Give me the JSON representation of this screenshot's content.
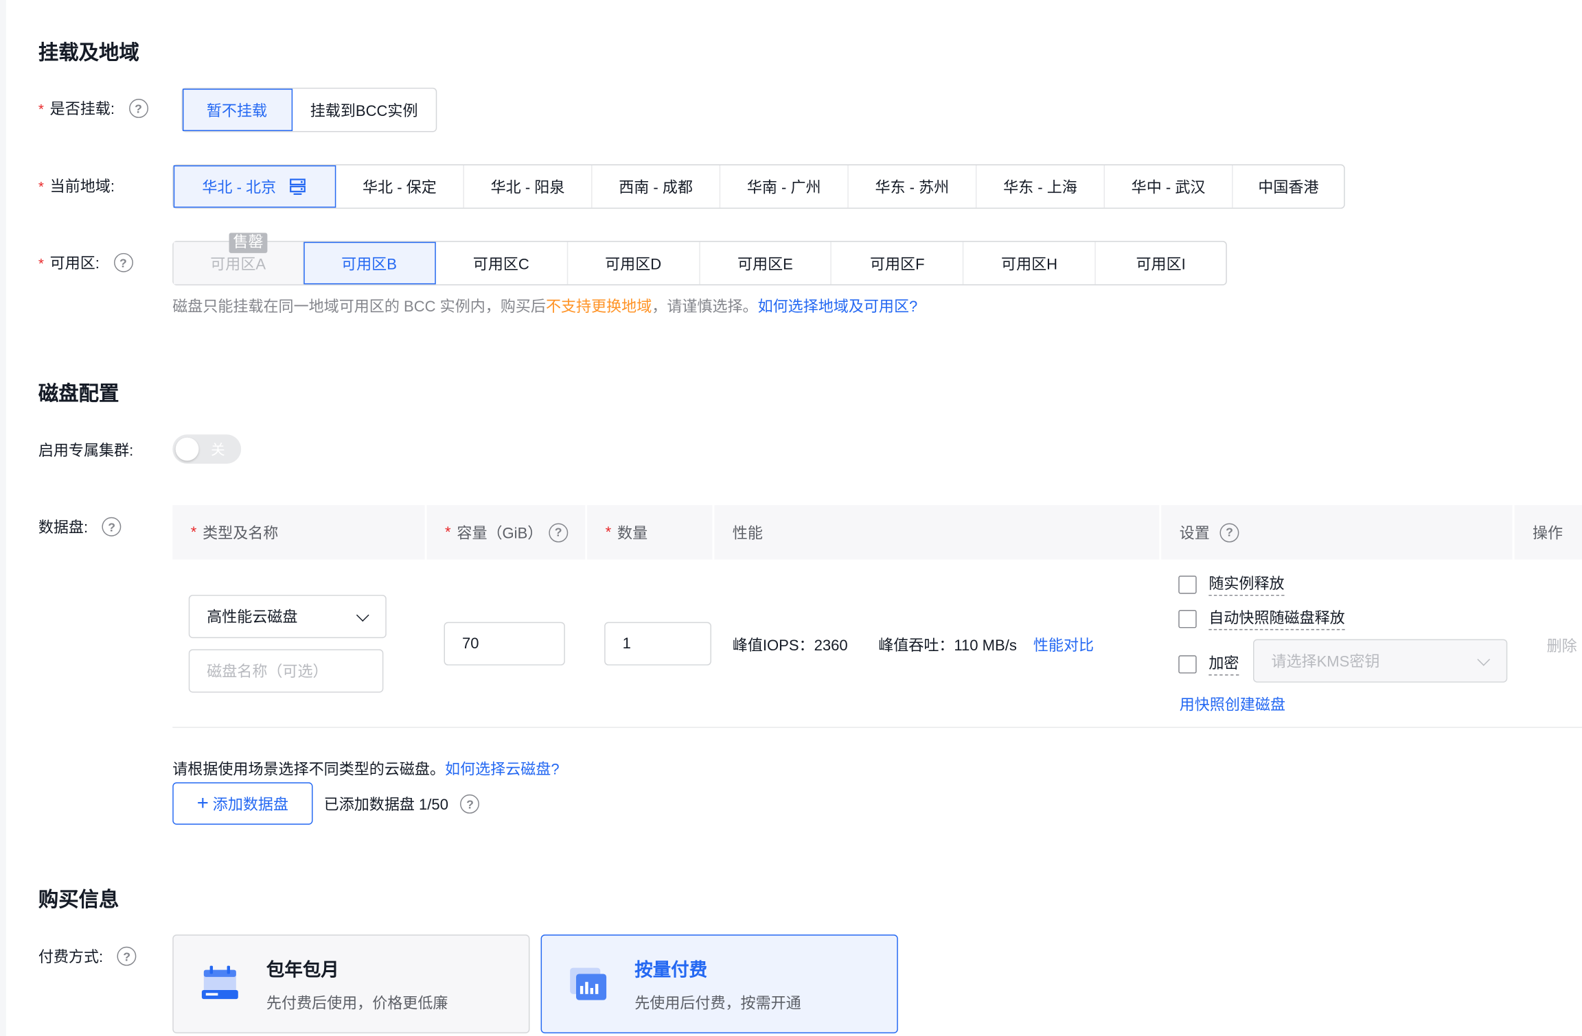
{
  "sections": {
    "mount_region": "挂载及地域",
    "disk_config": "磁盘配置",
    "purchase": "购买信息"
  },
  "mount": {
    "label": "是否挂载:",
    "options": [
      "暂不挂载",
      "挂载到BCC实例"
    ],
    "selected": 0
  },
  "region": {
    "label": "当前地域:",
    "options": [
      "华北 - 北京",
      "华北 - 保定",
      "华北 - 阳泉",
      "西南 - 成都",
      "华南 - 广州",
      "华东 - 苏州",
      "华东 - 上海",
      "华中 - 武汉",
      "中国香港"
    ],
    "selected": 0
  },
  "zone": {
    "label": "可用区:",
    "options": [
      "可用区A",
      "可用区B",
      "可用区C",
      "可用区D",
      "可用区E",
      "可用区F",
      "可用区H",
      "可用区I"
    ],
    "selected": 1,
    "disabled": [
      0
    ],
    "soldout_badge": "售罄"
  },
  "zone_hint": {
    "part1": "磁盘只能挂载在同一地域可用区的 BCC 实例内，购买后",
    "warn": "不支持更换地域",
    "part2": "，请谨慎选择。",
    "link": "如何选择地域及可用区?"
  },
  "dedicated": {
    "label": "启用专属集群:",
    "toggle_text": "关"
  },
  "data_disk": {
    "label": "数据盘:",
    "headers": {
      "type_name": "类型及名称",
      "capacity": "容量（GiB）",
      "quantity": "数量",
      "performance": "性能",
      "settings": "设置",
      "actions": "操作"
    },
    "row": {
      "type_value": "高性能云磁盘",
      "name_placeholder": "磁盘名称（可选）",
      "capacity": "70",
      "quantity": "1",
      "iops": "峰值IOPS：2360",
      "throughput": "峰值吞吐：110 MB/s",
      "compare_link": "性能对比",
      "opt_release": "随实例释放",
      "opt_snapshot": "自动快照随磁盘释放",
      "opt_encrypt": "加密",
      "kms_placeholder": "请选择KMS密钥",
      "snapshot_link": "用快照创建磁盘",
      "delete": "删除"
    },
    "hint": "请根据使用场景选择不同类型的云磁盘。",
    "hint_link": "如何选择云磁盘?",
    "add_button": "添加数据盘",
    "added_count": "已添加数据盘 1/50"
  },
  "payment": {
    "label": "付费方式:",
    "cards": [
      {
        "title": "包年包月",
        "desc": "先付费后使用，价格更低廉"
      },
      {
        "title": "按量付费",
        "desc": "先使用后付费，按需开通"
      }
    ],
    "selected": 1
  },
  "colors": {
    "primary": "#2468f2",
    "selected_bg": "#eef3fe",
    "warning": "#ff9326",
    "required": "#e8282a"
  }
}
